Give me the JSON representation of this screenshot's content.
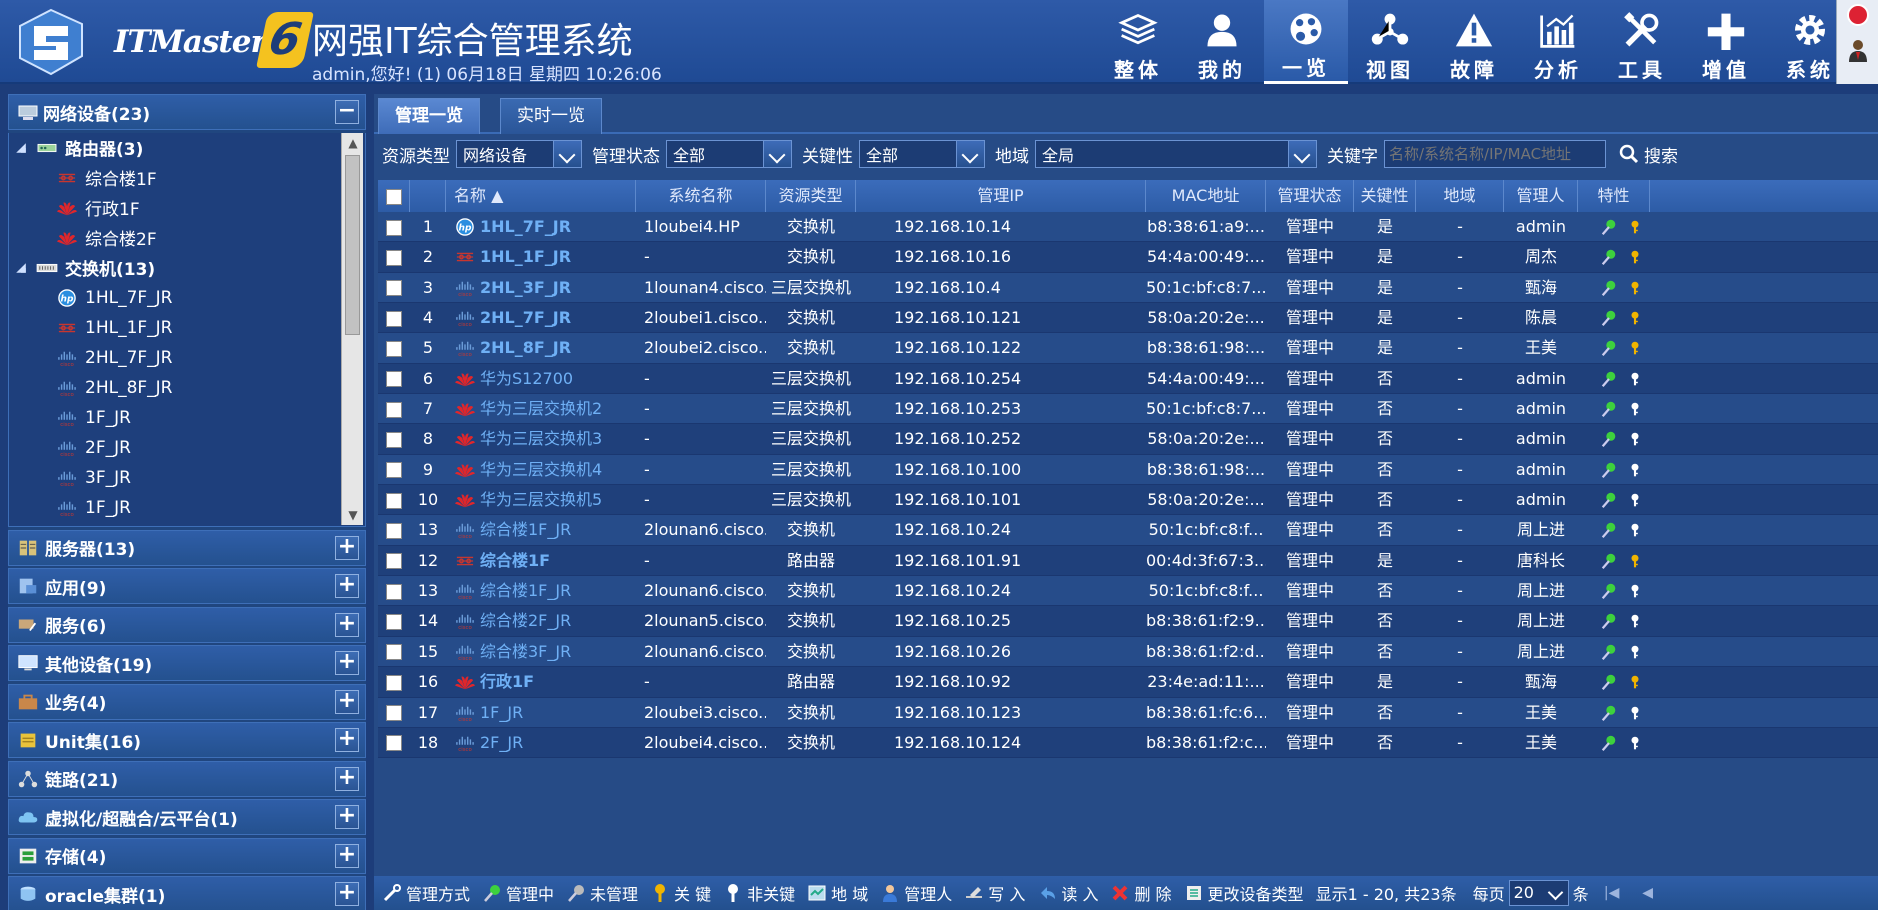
{
  "header": {
    "brand": "ITMaster",
    "brand_number": "6",
    "title": "网强IT综合管理系统",
    "subtitle": "admin,您好! (1) 06月18日 星期四 10:26:06"
  },
  "nav": [
    {
      "label": "整体",
      "icon": "layers-icon"
    },
    {
      "label": "我的",
      "icon": "user-icon"
    },
    {
      "label": "一览",
      "icon": "palette-icon",
      "active": true
    },
    {
      "label": "视图",
      "icon": "share-nodes-icon"
    },
    {
      "label": "故障",
      "icon": "warning-icon"
    },
    {
      "label": "分析",
      "icon": "chart-icon"
    },
    {
      "label": "工具",
      "icon": "tools-icon"
    },
    {
      "label": "增值",
      "icon": "plus-icon"
    },
    {
      "label": "系统",
      "icon": "gear-icon"
    }
  ],
  "sidebar": {
    "network": {
      "label": "网络设备(23)",
      "toggle": "−"
    },
    "tree": [
      {
        "type": "group",
        "label": "路由器(3)",
        "icon": "router-icon"
      },
      {
        "type": "leaf",
        "label": "综合楼1F",
        "icon": "cisco-router-icon"
      },
      {
        "type": "leaf",
        "label": "行政1F",
        "icon": "huawei-icon"
      },
      {
        "type": "leaf",
        "label": "综合楼2F",
        "icon": "huawei-icon"
      },
      {
        "type": "group",
        "label": "交换机(13)",
        "icon": "switch-icon"
      },
      {
        "type": "leaf",
        "label": "1HL_7F_JR",
        "icon": "hp-icon"
      },
      {
        "type": "leaf",
        "label": "1HL_1F_JR",
        "icon": "cisco-router-icon"
      },
      {
        "type": "leaf",
        "label": "2HL_7F_JR",
        "icon": "cisco-icon"
      },
      {
        "type": "leaf",
        "label": "2HL_8F_JR",
        "icon": "cisco-icon"
      },
      {
        "type": "leaf",
        "label": "1F_JR",
        "icon": "cisco-icon"
      },
      {
        "type": "leaf",
        "label": "2F_JR",
        "icon": "cisco-icon"
      },
      {
        "type": "leaf",
        "label": "3F_JR",
        "icon": "cisco-icon"
      },
      {
        "type": "leaf",
        "label": "1F_JR",
        "icon": "cisco-icon"
      }
    ],
    "groups": [
      {
        "label": "服务器(13)",
        "icon": "server-icon"
      },
      {
        "label": "应用(9)",
        "icon": "app-icon"
      },
      {
        "label": "服务(6)",
        "icon": "service-icon"
      },
      {
        "label": "其他设备(19)",
        "icon": "monitor-icon"
      },
      {
        "label": "业务(4)",
        "icon": "briefcase-icon"
      },
      {
        "label": "Unit集(16)",
        "icon": "unit-icon"
      },
      {
        "label": "链路(21)",
        "icon": "link-icon"
      },
      {
        "label": "虚拟化/超融合/云平台(1)",
        "icon": "cloud-icon"
      },
      {
        "label": "存储(4)",
        "icon": "storage-icon"
      },
      {
        "label": "oracle集群(1)",
        "icon": "database-icon"
      }
    ],
    "expand_symbol": "+"
  },
  "tabs": [
    {
      "label": "管理一览",
      "active": true
    },
    {
      "label": "实时一览",
      "active": false
    }
  ],
  "filters": {
    "type_label": "资源类型",
    "type_value": "网络设备",
    "status_label": "管理状态",
    "status_value": "全部",
    "key_label": "关键性",
    "key_value": "全部",
    "region_label": "地域",
    "region_value": "全局",
    "keyword_label": "关键字",
    "keyword_placeholder": "名称/系统名称/IP/MAC地址",
    "search_label": "搜索"
  },
  "table": {
    "columns": [
      "名称 ▲",
      "系统名称",
      "资源类型",
      "管理IP",
      "MAC地址",
      "管理状态",
      "关键性",
      "地域",
      "管理人",
      "特性"
    ],
    "rows": [
      {
        "no": "1",
        "name": "1HL_7F_JR",
        "icon": "hp-icon",
        "bold": true,
        "sys": "1loubei4.HP",
        "type": "交换机",
        "ip": "192.168.10.14",
        "mac": "b8:38:61:a9:...",
        "status": "管理中",
        "key": "是",
        "region": "-",
        "owner": "admin",
        "keyicon": "gold"
      },
      {
        "no": "2",
        "name": "1HL_1F_JR",
        "icon": "cisco-router-icon",
        "bold": true,
        "sys": "-",
        "type": "交换机",
        "ip": "192.168.10.16",
        "mac": "54:4a:00:49:...",
        "status": "管理中",
        "key": "是",
        "region": "-",
        "owner": "周杰",
        "keyicon": "gold"
      },
      {
        "no": "3",
        "name": "2HL_3F_JR",
        "icon": "cisco-icon",
        "bold": true,
        "sys": "1lounan4.cisco...",
        "type": "三层交换机",
        "ip": "192.168.10.4",
        "mac": "50:1c:bf:c8:7...",
        "status": "管理中",
        "key": "是",
        "region": "-",
        "owner": "甄海",
        "keyicon": "gold"
      },
      {
        "no": "4",
        "name": "2HL_7F_JR",
        "icon": "cisco-icon",
        "bold": true,
        "sys": "2loubei1.cisco....",
        "type": "交换机",
        "ip": "192.168.10.121",
        "mac": "58:0a:20:2e:...",
        "status": "管理中",
        "key": "是",
        "region": "-",
        "owner": "陈晨",
        "keyicon": "gold"
      },
      {
        "no": "5",
        "name": "2HL_8F_JR",
        "icon": "cisco-icon",
        "bold": true,
        "sys": "2loubei2.cisco....",
        "type": "交换机",
        "ip": "192.168.10.122",
        "mac": "b8:38:61:98:...",
        "status": "管理中",
        "key": "是",
        "region": "-",
        "owner": "王美",
        "keyicon": "gold"
      },
      {
        "no": "6",
        "name": "华为S12700",
        "icon": "huawei-icon",
        "bold": false,
        "sys": "-",
        "type": "三层交换机",
        "ip": "192.168.10.254",
        "mac": "54:4a:00:49:...",
        "status": "管理中",
        "key": "否",
        "region": "-",
        "owner": "admin",
        "keyicon": "white"
      },
      {
        "no": "7",
        "name": "华为三层交换机2",
        "icon": "huawei-icon",
        "bold": false,
        "sys": "-",
        "type": "三层交换机",
        "ip": "192.168.10.253",
        "mac": "50:1c:bf:c8:7...",
        "status": "管理中",
        "key": "否",
        "region": "-",
        "owner": "admin",
        "keyicon": "white"
      },
      {
        "no": "8",
        "name": "华为三层交换机3",
        "icon": "huawei-icon",
        "bold": false,
        "sys": "-",
        "type": "三层交换机",
        "ip": "192.168.10.252",
        "mac": "58:0a:20:2e:...",
        "status": "管理中",
        "key": "否",
        "region": "-",
        "owner": "admin",
        "keyicon": "white"
      },
      {
        "no": "9",
        "name": "华为三层交换机4",
        "icon": "huawei-icon",
        "bold": false,
        "sys": "-",
        "type": "三层交换机",
        "ip": "192.168.10.100",
        "mac": "b8:38:61:98:...",
        "status": "管理中",
        "key": "否",
        "region": "-",
        "owner": "admin",
        "keyicon": "white"
      },
      {
        "no": "10",
        "name": "华为三层交换机5",
        "icon": "huawei-icon",
        "bold": false,
        "sys": "-",
        "type": "三层交换机",
        "ip": "192.168.10.101",
        "mac": "58:0a:20:2e:...",
        "status": "管理中",
        "key": "否",
        "region": "-",
        "owner": "admin",
        "keyicon": "white"
      },
      {
        "no": "13",
        "name": "综合楼1F_JR",
        "icon": "cisco-icon",
        "bold": false,
        "sys": "2lounan6.cisco....",
        "type": "交换机",
        "ip": "192.168.10.24",
        "mac": "50:1c:bf:c8:f...",
        "status": "管理中",
        "key": "否",
        "region": "-",
        "owner": "周上进",
        "keyicon": "white"
      },
      {
        "no": "12",
        "name": "综合楼1F",
        "icon": "cisco-router-icon",
        "bold": true,
        "sys": "-",
        "type": "路由器",
        "ip": "192.168.101.91",
        "mac": "00:4d:3f:67:3...",
        "status": "管理中",
        "key": "是",
        "region": "-",
        "owner": "唐科长",
        "keyicon": "gold"
      },
      {
        "no": "13",
        "name": "综合楼1F_JR",
        "icon": "cisco-icon",
        "bold": false,
        "sys": "2lounan6.cisco....",
        "type": "交换机",
        "ip": "192.168.10.24",
        "mac": "50:1c:bf:c8:f...",
        "status": "管理中",
        "key": "否",
        "region": "-",
        "owner": "周上进",
        "keyicon": "white"
      },
      {
        "no": "14",
        "name": "综合楼2F_JR",
        "icon": "cisco-icon",
        "bold": false,
        "sys": "2lounan5.cisco....",
        "type": "交换机",
        "ip": "192.168.10.25",
        "mac": "b8:38:61:f2:9...",
        "status": "管理中",
        "key": "否",
        "region": "-",
        "owner": "周上进",
        "keyicon": "white"
      },
      {
        "no": "15",
        "name": "综合楼3F_JR",
        "icon": "cisco-icon",
        "bold": false,
        "sys": "2lounan6.cisco....",
        "type": "交换机",
        "ip": "192.168.10.26",
        "mac": "b8:38:61:f2:d...",
        "status": "管理中",
        "key": "否",
        "region": "-",
        "owner": "周上进",
        "keyicon": "white"
      },
      {
        "no": "16",
        "name": "行政1F",
        "icon": "huawei-icon",
        "bold": true,
        "sys": "-",
        "type": "路由器",
        "ip": "192.168.10.92",
        "mac": "23:4e:ad:11:...",
        "status": "管理中",
        "key": "是",
        "region": "-",
        "owner": "甄海",
        "keyicon": "gold"
      },
      {
        "no": "17",
        "name": "1F_JR",
        "icon": "cisco-icon",
        "bold": false,
        "sys": "2loubei3.cisco....",
        "type": "交换机",
        "ip": "192.168.10.123",
        "mac": "b8:38:61:fc:6...",
        "status": "管理中",
        "key": "否",
        "region": "-",
        "owner": "王美",
        "keyicon": "white"
      },
      {
        "no": "18",
        "name": "2F_JR",
        "icon": "cisco-icon",
        "bold": false,
        "sys": "2loubei4.cisco....",
        "type": "交换机",
        "ip": "192.168.10.124",
        "mac": "b8:38:61:f2:c...",
        "status": "管理中",
        "key": "否",
        "region": "-",
        "owner": "王美",
        "keyicon": "white"
      }
    ]
  },
  "footer": {
    "actions": [
      {
        "label": "管理方式",
        "icon": "wrench-icon"
      },
      {
        "label": "管理中",
        "icon": "managed-icon"
      },
      {
        "label": "未管理",
        "icon": "unmanaged-icon"
      },
      {
        "label": "关 键",
        "icon": "gold-key-icon"
      },
      {
        "label": "非关键",
        "icon": "white-key-icon"
      },
      {
        "label": "地 域",
        "icon": "map-icon"
      },
      {
        "label": "管理人",
        "icon": "person-icon"
      },
      {
        "label": "写 入",
        "icon": "write-icon"
      },
      {
        "label": "读 入",
        "icon": "read-icon"
      },
      {
        "label": "删 除",
        "icon": "delete-icon"
      },
      {
        "label": "更改设备类型",
        "icon": "change-type-icon"
      }
    ],
    "summary": "显示1 - 20, 共23条",
    "page_size_label": "每页",
    "page_size": "20",
    "page_size_unit": "条"
  },
  "colors": {
    "link": "#6fb0f5",
    "header_bg": "#2e5aa8",
    "huawei_red": "#e0262b",
    "cisco_red": "#c8362f",
    "gold": "#f0b400",
    "green": "#3dd13d"
  }
}
